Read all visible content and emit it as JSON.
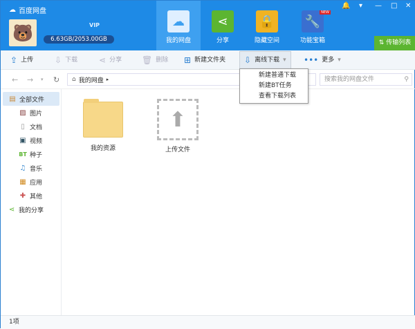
{
  "app": {
    "title": "百度网盘"
  },
  "account": {
    "quota": "6.63GB/2053.00GB",
    "vip_label": "VIP"
  },
  "nav": [
    {
      "label": "我的网盘"
    },
    {
      "label": "分享"
    },
    {
      "label": "隐藏空间"
    },
    {
      "label": "功能宝箱",
      "badge": "NEW"
    }
  ],
  "transfer_label": "传输列表",
  "toolbar": {
    "upload": "上传",
    "download": "下载",
    "share": "分享",
    "delete": "删除",
    "new_folder": "新建文件夹",
    "offline": "离线下载",
    "more": "更多"
  },
  "dropdown": [
    "新建普通下载",
    "新建BT任务",
    "查看下载列表"
  ],
  "address": {
    "path": "我的网盘",
    "search_placeholder": "搜索我的网盘文件"
  },
  "sidebar": [
    {
      "label": "全部文件"
    },
    {
      "label": "图片"
    },
    {
      "label": "文档"
    },
    {
      "label": "视频"
    },
    {
      "label": "种子"
    },
    {
      "label": "音乐"
    },
    {
      "label": "应用"
    },
    {
      "label": "其他"
    },
    {
      "label": "我的分享"
    }
  ],
  "files": [
    {
      "name": "我的资源"
    },
    {
      "name": "上传文件"
    }
  ],
  "status": "1项"
}
